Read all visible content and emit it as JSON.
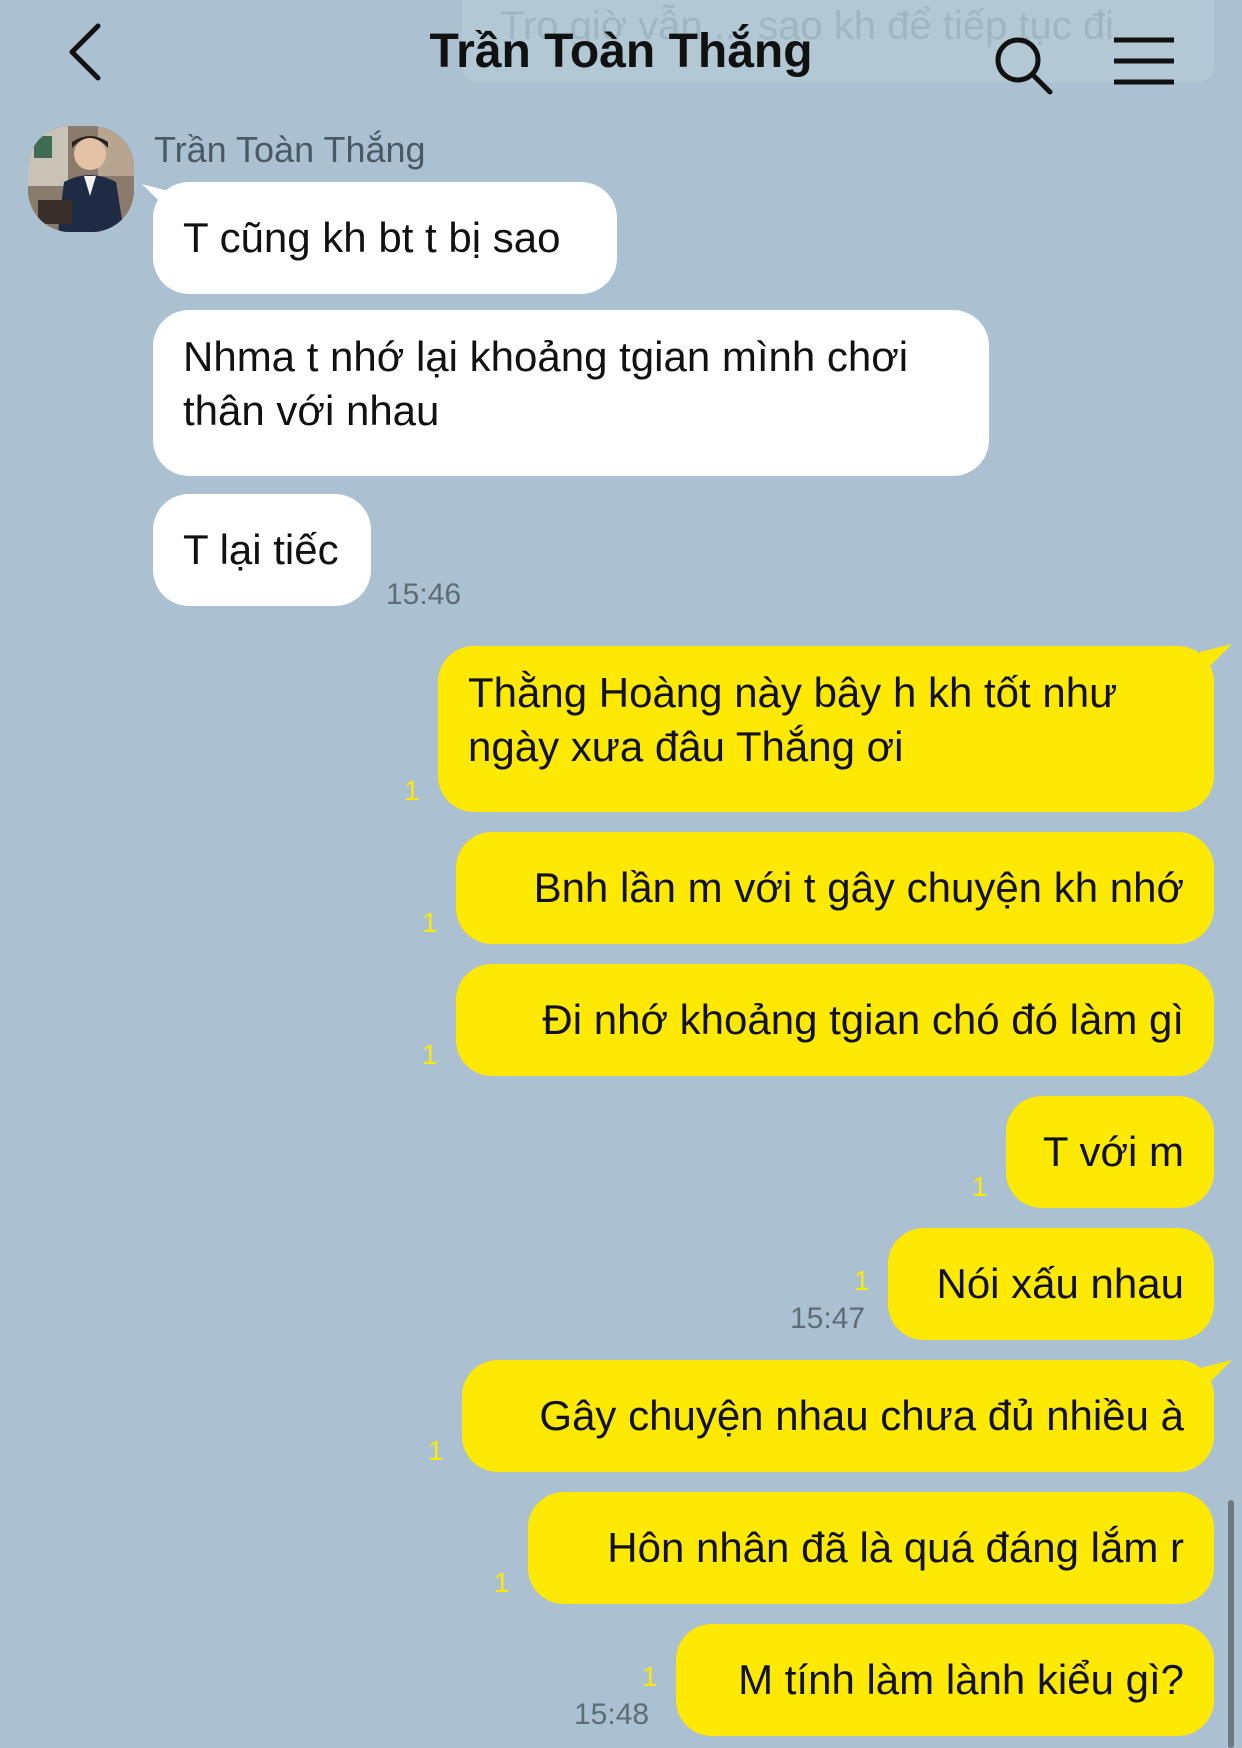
{
  "header": {
    "title": "Trần Toàn Thắng",
    "pinned_preview": "Tro giờ vẫn ... sao kh để tiếp tục đi"
  },
  "contact": {
    "name": "Trần Toàn Thắng"
  },
  "incoming": [
    {
      "text": "T cũng kh bt t bị sao"
    },
    {
      "text": "Nhma t nhớ lại khoảng tgian mình chơi thân với nhau"
    },
    {
      "text": "T lại tiếc",
      "time": "15:46"
    }
  ],
  "outgoing": [
    {
      "text": "Thằng Hoàng này bây h kh tốt như ngày xưa đâu Thắng ơi",
      "unread": "1"
    },
    {
      "text": "Bnh lần m với t gây chuyện kh nhớ",
      "unread": "1"
    },
    {
      "text": "Đi nhớ khoảng tgian chó đó làm gì",
      "unread": "1"
    },
    {
      "text": "T với m",
      "unread": "1"
    },
    {
      "text": "Nói xấu nhau",
      "unread": "1",
      "time": "15:47"
    },
    {
      "text": "Gây chuyện nhau chưa đủ nhiều à",
      "unread": "1"
    },
    {
      "text": "Hôn nhân đã là quá đáng lắm r",
      "unread": "1"
    },
    {
      "text": "M tính làm lành kiểu gì?",
      "unread": "1",
      "time": "15:48"
    }
  ],
  "colors": {
    "background": "#abc1d1",
    "outgoing_bubble": "#fde904",
    "incoming_bubble": "#ffffff",
    "unread_count": "#fde904"
  },
  "icons": [
    "back-arrow-icon",
    "search-icon",
    "menu-icon"
  ]
}
